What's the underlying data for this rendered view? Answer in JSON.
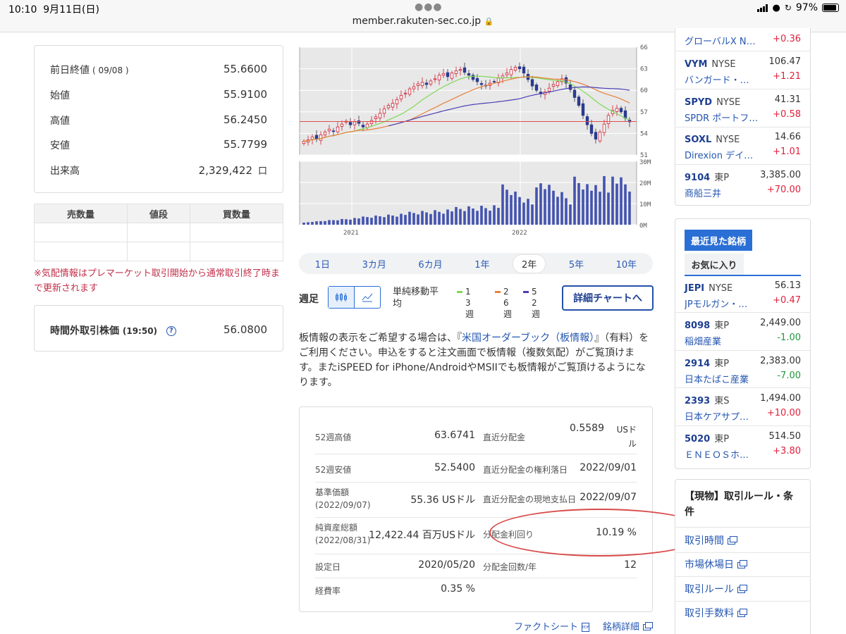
{
  "status_bar": {
    "time": "10:10",
    "date": "9月11日(日)",
    "url": "member.rakuten-sec.co.jp",
    "battery": "97%"
  },
  "price_card": {
    "rows": [
      {
        "label": "前日終値",
        "sub": "( 09/08 )",
        "value": "55.6600"
      },
      {
        "label": "始値",
        "value": "55.9100"
      },
      {
        "label": "高値",
        "value": "56.2450"
      },
      {
        "label": "安値",
        "value": "55.7799"
      },
      {
        "label": "出来高",
        "value": "2,329,422",
        "unit": "口"
      }
    ]
  },
  "orderbook": {
    "headers": [
      "売数量",
      "値段",
      "買数量"
    ]
  },
  "quote_note": "※気配情報はプレマーケット取引開始から通常取引終了時まで更新されます",
  "after_hours": {
    "label": "時間外取引株価",
    "time": "(19:50)",
    "help": "?",
    "value": "56.0800"
  },
  "chart_data": {
    "type": "line",
    "price_axis": [
      66,
      63,
      60,
      57,
      54,
      51
    ],
    "volume_axis": [
      "30M",
      "20M",
      "10M",
      "0M"
    ],
    "x_ticks": [
      "2021",
      "2022"
    ],
    "series": [
      {
        "name": "13週",
        "color": "#7ed957"
      },
      {
        "name": "26週",
        "color": "#e8803a"
      },
      {
        "name": "52週",
        "color": "#4b3fb4"
      }
    ],
    "reference_price": 55.66,
    "price": [
      52.9,
      53.1,
      53.5,
      53.2,
      53.8,
      54.2,
      54.6,
      54.3,
      54.9,
      55.3,
      55.7,
      55.2,
      55.6,
      55.4,
      54.9,
      55.3,
      55.8,
      56.3,
      56.8,
      57.4,
      57.9,
      58.2,
      58.7,
      59.3,
      59.6,
      60.2,
      60.5,
      60.9,
      61.1,
      60.8,
      61.3,
      61.6,
      62.1,
      62.3,
      61.9,
      62.4,
      62.7,
      62.9,
      62.5,
      62.1,
      61.5,
      61.2,
      60.8,
      60.6,
      61.0,
      61.2,
      61.7,
      62.0,
      62.4,
      62.9,
      63.2,
      63.0,
      62.4,
      61.5,
      60.6,
      60.0,
      59.5,
      59.8,
      60.3,
      60.8,
      61.2,
      61.6,
      61.0,
      60.1,
      59.0,
      57.9,
      56.5,
      55.2,
      54.0,
      53.2,
      54.2,
      55.3,
      56.5,
      57.2,
      57.5,
      57.0,
      56.1,
      55.6
    ]
  },
  "periods": [
    "1日",
    "3カ月",
    "6カ月",
    "1年",
    "2年",
    "5年",
    "10年"
  ],
  "selected_period": "2年",
  "chart_controls": {
    "foot_label": "週足",
    "ma_label": "単純移動平均",
    "detail_button": "詳細チャートへ"
  },
  "info_paragraph": {
    "before": "板情報の表示をご希望する場合は、『",
    "link": "米国オーダーブック（板情報）",
    "after": "』（有料）をご利用ください。申込をすると注文画面で板情報（複数気配）がご覧頂けます。またiSPEED for iPhone/AndroidやMSIIでも板情報がご覧頂けるようになります。"
  },
  "stats": {
    "left": [
      {
        "label": "52週高値",
        "value": "63.6741"
      },
      {
        "label": "52週安値",
        "value": "52.5400"
      },
      {
        "label": "基準価額",
        "sub": "(2022/09/07)",
        "value": "55.36 USドル"
      },
      {
        "label": "純資産総額",
        "sub": "(2022/08/31)",
        "value": "12,422.44 百万USドル"
      },
      {
        "label": "設定日",
        "value": "2020/05/20"
      },
      {
        "label": "経費率",
        "value": "0.35 %"
      }
    ],
    "right": [
      {
        "label": "直近分配金",
        "value": "0.5589",
        "unit": "USド ル"
      },
      {
        "label": "直近分配金の権利落日",
        "value": "2022/09/01"
      },
      {
        "label": "直近分配金の現地支払日",
        "value": "2022/09/07"
      },
      {
        "label": "分配金利回り",
        "value": "10.19 %"
      },
      {
        "label": "分配金回数/年",
        "value": "12"
      }
    ]
  },
  "bottom_links": {
    "factsheet": "ファクトシート",
    "pdf": "PDF",
    "detail": "銘柄詳細"
  },
  "watchlist_top": [
    {
      "name": "グローバルX N…",
      "change": "+0.36",
      "dir": "pos"
    },
    {
      "code": "VYM",
      "market": "NYSE",
      "price": "106.47",
      "name": "バンガード・…",
      "change": "+1.21",
      "dir": "pos"
    },
    {
      "code": "SPYD",
      "market": "NYSE",
      "price": "41.31",
      "name": "SPDR ポートフ…",
      "change": "+0.58",
      "dir": "pos"
    },
    {
      "code": "SOXL",
      "market": "NYSE",
      "price": "14.66",
      "name": "Direxion デイ…",
      "change": "+1.01",
      "dir": "pos"
    },
    {
      "code": "9104",
      "market": "東P",
      "price": "3,385.00",
      "name": "商船三井",
      "change": "+70.00",
      "dir": "pos"
    }
  ],
  "recent_tabs": {
    "recent": "最近見た銘柄",
    "fav": "お気に入り"
  },
  "watchlist_recent": [
    {
      "code": "JEPI",
      "market": "NYSE",
      "price": "56.13",
      "name": "JPモルガン・…",
      "change": "+0.47",
      "dir": "pos"
    },
    {
      "code": "8098",
      "market": "東P",
      "price": "2,449.00",
      "name": "稲畑産業",
      "change": "-1.00",
      "dir": "neg"
    },
    {
      "code": "2914",
      "market": "東P",
      "price": "2,383.00",
      "name": "日本たばこ産業",
      "change": "-7.00",
      "dir": "neg"
    },
    {
      "code": "2393",
      "market": "東S",
      "price": "1,494.00",
      "name": "日本ケアサプ…",
      "change": "+10.00",
      "dir": "pos"
    },
    {
      "code": "5020",
      "market": "東P",
      "price": "514.50",
      "name": "ＥＮＥＯＳホ…",
      "change": "+3.80",
      "dir": "pos"
    }
  ],
  "rules": {
    "title": "【現物】取引ルール・条件",
    "links": [
      "取引時間",
      "市場休場日",
      "取引ルール",
      "取引手数料"
    ]
  },
  "colors": {
    "up": "#e0203c",
    "down": "#1f9a3c",
    "link": "#2456b0",
    "annotation": "#d84a4a"
  }
}
